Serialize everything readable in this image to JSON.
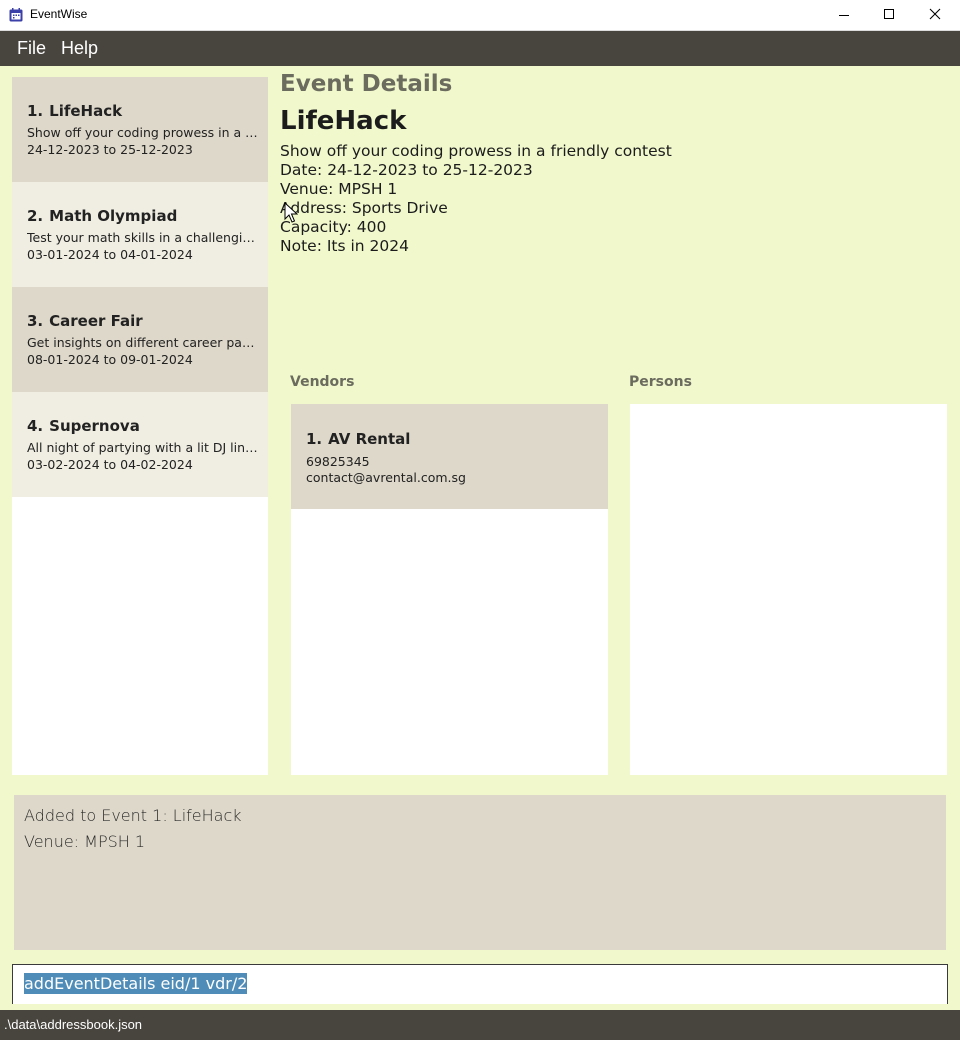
{
  "window": {
    "title": "EventWise"
  },
  "menu": {
    "file_label": "File",
    "help_label": "Help"
  },
  "events": [
    {
      "index": "1.",
      "name": "LifeHack",
      "description": "Show off your coding prowess in a friendly contest",
      "dates": "24-12-2023 to 25-12-2023"
    },
    {
      "index": "2.",
      "name": "Math Olympiad",
      "description": "Test your math skills in a challenging contest",
      "dates": "03-01-2024 to 04-01-2024"
    },
    {
      "index": "3.",
      "name": "Career Fair",
      "description": "Get insights on different career paths",
      "dates": "08-01-2024 to 09-01-2024"
    },
    {
      "index": "4.",
      "name": "Supernova",
      "description": "All night of partying with a lit DJ lineup",
      "dates": "03-02-2024 to 04-02-2024"
    }
  ],
  "details": {
    "header": "Event Details",
    "name": "LifeHack",
    "description": "Show off your coding prowess in a friendly contest",
    "date": "Date: 24-12-2023 to 25-12-2023",
    "venue": "Venue: MPSH 1",
    "address": "Address: Sports Drive",
    "capacity": "Capacity: 400",
    "note": "Note: Its in 2024"
  },
  "vendors": {
    "label": "Vendors",
    "items": [
      {
        "index": "1.",
        "name": "AV Rental",
        "phone": "69825345",
        "email": "contact@avrental.com.sg"
      }
    ]
  },
  "persons": {
    "label": "Persons"
  },
  "result": {
    "line1": "Added to Event 1: LifeHack",
    "line2": "Venue: MPSH 1"
  },
  "command": {
    "value": "addEventDetails eid/1 vdr/2"
  },
  "status": {
    "path": ".\\data\\addressbook.json"
  },
  "colors": {
    "background": "#f1f8cc",
    "bar": "#48443e",
    "card_dark": "#ded8ca",
    "card_light": "#f0eee2",
    "selection": "#4f8db8"
  }
}
